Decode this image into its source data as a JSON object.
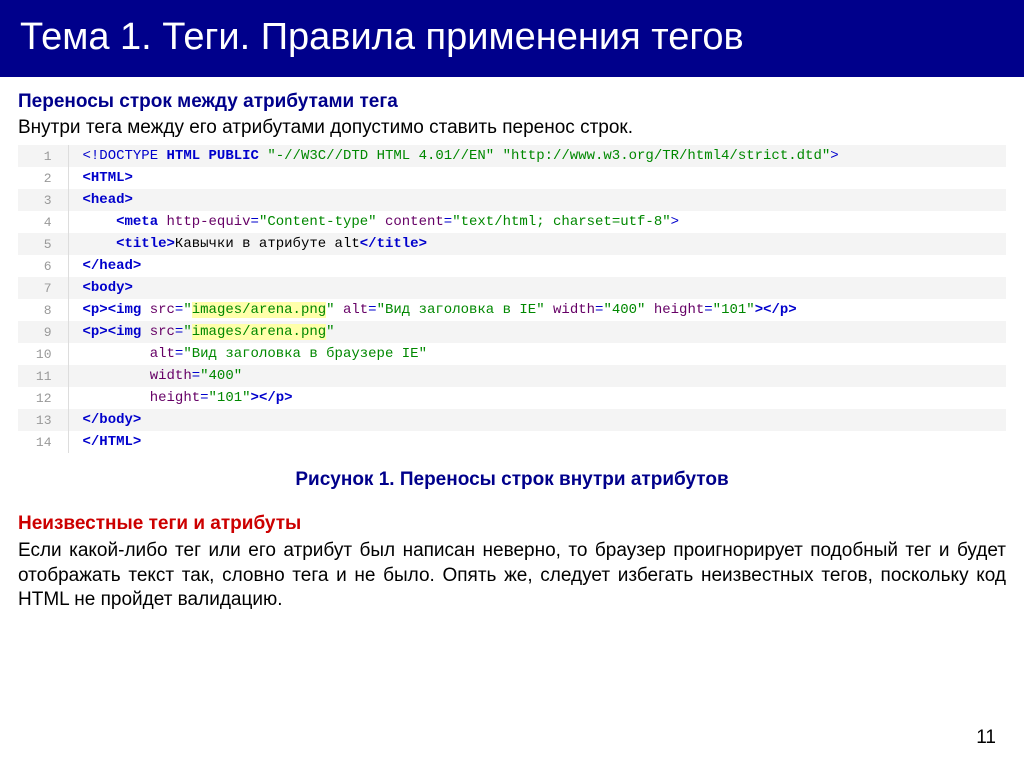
{
  "header": "Тема 1. Теги. Правила применения тегов",
  "section1": {
    "title": "Переносы строк между атрибутами тега",
    "desc": "Внутри тега между его атрибутами допустимо ставить перенос строк."
  },
  "code": {
    "l1a": "<!DOCTYPE",
    "l1b": " HTML PUBLIC",
    "l1c": " \"-//W3C//DTD HTML 4.01//EN\" \"http://www.w3.org/TR/html4/strict.dtd\"",
    "l1d": ">",
    "l2a": "<HTML>",
    "l3a": "<head>",
    "l4a": "    <meta",
    "l4b": " http-equiv",
    "l4c": "=",
    "l4d": "\"Content-type\"",
    "l4e": " content",
    "l4f": "=",
    "l4g": "\"text/html; charset=utf-8\"",
    "l4h": ">",
    "l5a": "    <title>",
    "l5b": "Кавычки в атрибуте alt",
    "l5c": "</title>",
    "l6a": "</head>",
    "l7a": "<body>",
    "l8a": "<p><img",
    "l8b": " src",
    "l8eq": "=",
    "l8c": "\"",
    "l8d": "images/arena.png",
    "l8e": "\"",
    "l8f": " alt",
    "l8g": "=",
    "l8h": "\"Вид заголовка в IE\"",
    "l8i": " width",
    "l8j": "=",
    "l8k": "\"400\"",
    "l8l": " height",
    "l8m": "=",
    "l8n": "\"101\"",
    "l8o": "></p>",
    "l9a": "<p><img",
    "l9b": " src",
    "l9eq": "=",
    "l9c": "\"",
    "l9d": "images/arena.png",
    "l9e": "\"",
    "l10a": "        alt",
    "l10b": "=",
    "l10c": "\"Вид заголовка в браузере IE\"",
    "l11a": "        width",
    "l11b": "=",
    "l11c": "\"400\"",
    "l12a": "        height",
    "l12b": "=",
    "l12c": "\"101\"",
    "l12d": "></p>",
    "l13a": "</body>",
    "l14a": "</HTML>"
  },
  "caption": "Рисунок 1. Переносы строк внутри атрибутов",
  "section2": {
    "title": "Неизвестные теги и атрибуты",
    "para": "Если какой-либо тег или его атрибут был написан неверно, то браузер проигнорирует подобный тег и будет отображать текст так, словно тега и не было. Опять же, следует избегать неизвестных тегов, поскольку код HTML не пройдет валидацию."
  },
  "pagenum": "11",
  "ln": {
    "1": "1",
    "2": "2",
    "3": "3",
    "4": "4",
    "5": "5",
    "6": "6",
    "7": "7",
    "8": "8",
    "9": "9",
    "10": "10",
    "11": "11",
    "12": "12",
    "13": "13",
    "14": "14"
  }
}
